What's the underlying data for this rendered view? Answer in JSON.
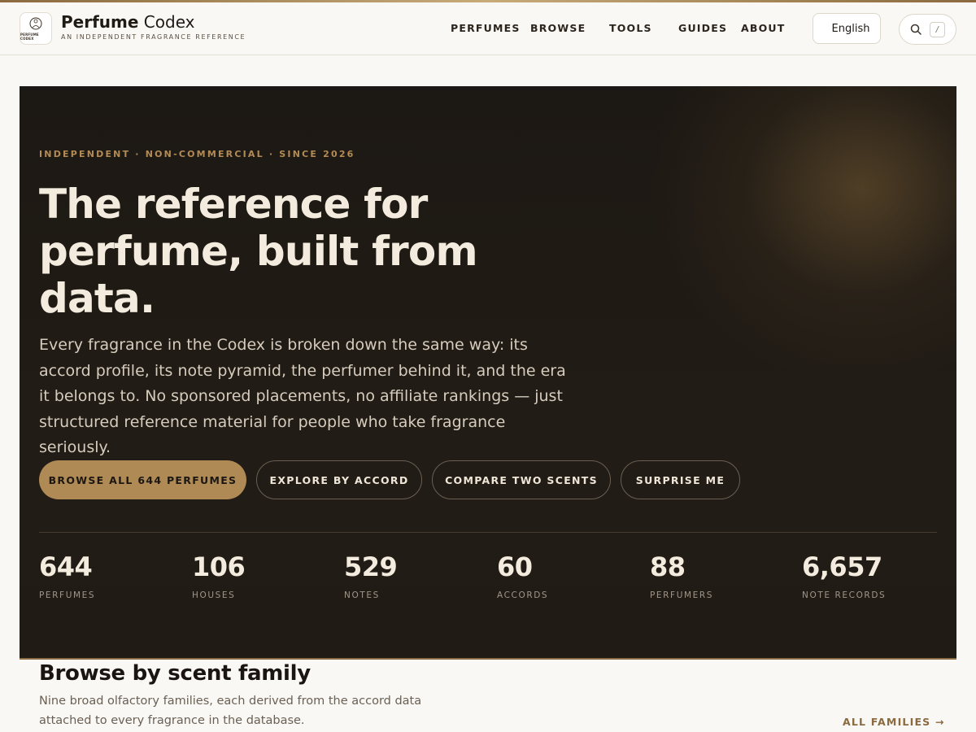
{
  "header": {
    "logo_text": "Perfume Codex",
    "brand_bold": "Perfume",
    "brand_light": "Codex",
    "tagline": "An independent fragrance reference",
    "nav": [
      "Perfumes",
      "Browse",
      "Tools",
      "Guides",
      "About"
    ],
    "language": "English",
    "search_shortcut": "/"
  },
  "hero": {
    "eyebrow": "Independent · Non-commercial · Since 2026",
    "title": "The reference for perfume, built from data.",
    "lede": "Every fragrance in the Codex is broken down the same way: its accord profile, its note pyramid, the perfumer behind it, and the era it belongs to. No sponsored placements, no affiliate rankings — just structured reference material for people who take fragrance seriously.",
    "buttons": [
      "Browse all 644 perfumes",
      "Explore by accord",
      "Compare two scents",
      "Surprise me"
    ],
    "stats": [
      {
        "value": "644",
        "label": "Perfumes"
      },
      {
        "value": "106",
        "label": "Houses"
      },
      {
        "value": "529",
        "label": "Notes"
      },
      {
        "value": "60",
        "label": "Accords"
      },
      {
        "value": "88",
        "label": "Perfumers"
      },
      {
        "value": "6,657",
        "label": "Note records"
      }
    ]
  },
  "families": {
    "title": "Browse by scent family",
    "lede": "Nine broad olfactory families, each derived from the accord data attached to every fragrance in the database.",
    "link": "All families →"
  },
  "colors": {
    "accent": "#b08a55",
    "hero_bg": "#1f1a14",
    "page_bg": "#faf8f4"
  },
  "icons": {
    "logo": "perfume-bottle-icon",
    "search": "search-icon"
  }
}
